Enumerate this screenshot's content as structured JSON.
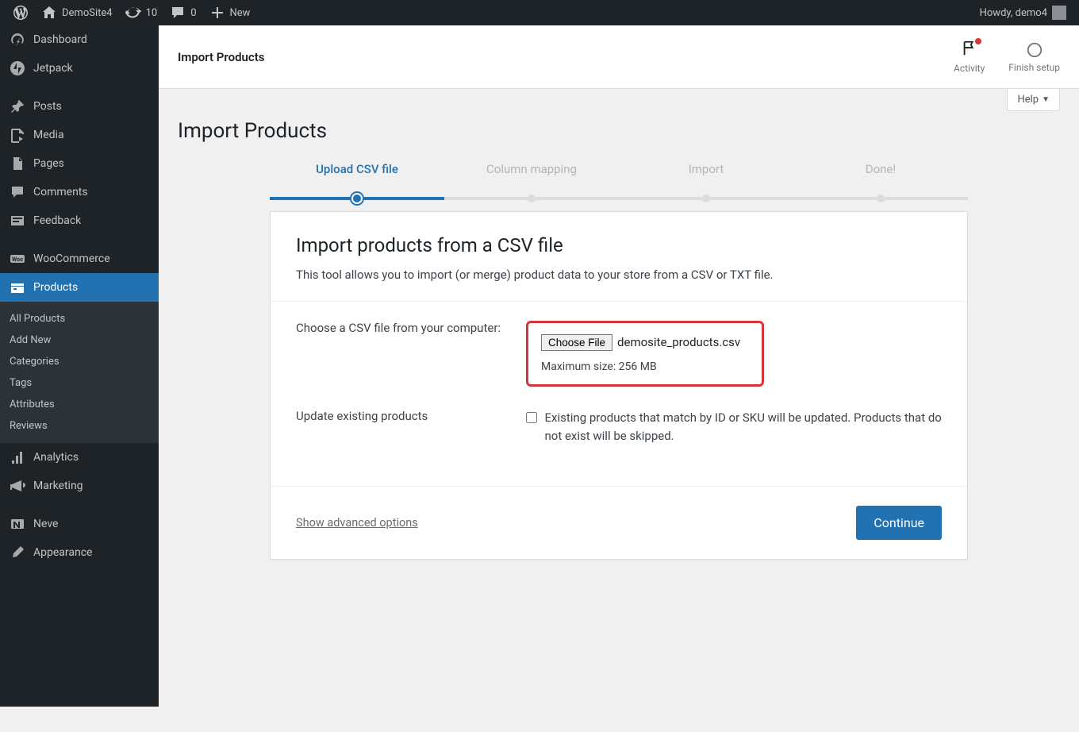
{
  "adminbar": {
    "site_name": "DemoSite4",
    "updates_count": "10",
    "comments_count": "0",
    "new_label": "New",
    "greeting": "Howdy, demo4"
  },
  "sidebar": {
    "items": [
      {
        "label": "Dashboard"
      },
      {
        "label": "Jetpack"
      },
      {
        "label": "Posts"
      },
      {
        "label": "Media"
      },
      {
        "label": "Pages"
      },
      {
        "label": "Comments"
      },
      {
        "label": "Feedback"
      },
      {
        "label": "WooCommerce"
      },
      {
        "label": "Products"
      },
      {
        "label": "Analytics"
      },
      {
        "label": "Marketing"
      },
      {
        "label": "Neve"
      },
      {
        "label": "Appearance"
      }
    ],
    "submenu": [
      {
        "label": "All Products"
      },
      {
        "label": "Add New"
      },
      {
        "label": "Categories"
      },
      {
        "label": "Tags"
      },
      {
        "label": "Attributes"
      },
      {
        "label": "Reviews"
      }
    ]
  },
  "headerbar": {
    "title": "Import Products",
    "activity": "Activity",
    "finish": "Finish setup"
  },
  "help": "Help",
  "page_title": "Import Products",
  "steps": [
    {
      "label": "Upload CSV file"
    },
    {
      "label": "Column mapping"
    },
    {
      "label": "Import"
    },
    {
      "label": "Done!"
    }
  ],
  "panel": {
    "heading": "Import products from a CSV file",
    "desc": "This tool allows you to import (or merge) product data to your store from a CSV or TXT file.",
    "choose_label": "Choose a CSV file from your computer:",
    "choose_btn": "Choose File",
    "filename": "demosite_products.csv",
    "max_size": "Maximum size: 256 MB",
    "update_label": "Update existing products",
    "update_desc": "Existing products that match by ID or SKU will be updated. Products that do not exist will be skipped.",
    "advanced": "Show advanced options",
    "continue": "Continue"
  }
}
